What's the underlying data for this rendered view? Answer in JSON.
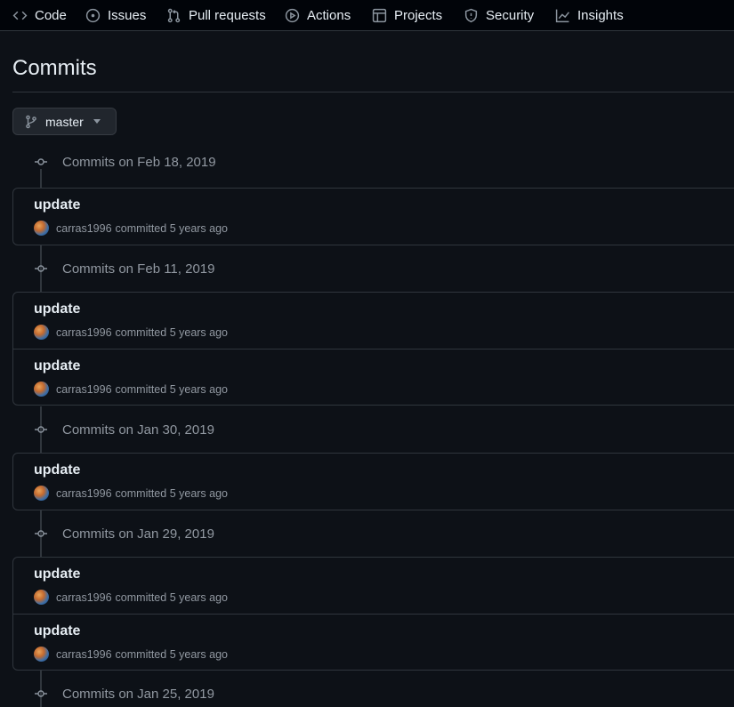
{
  "nav": {
    "items": [
      {
        "label": "Code",
        "icon": "code-icon"
      },
      {
        "label": "Issues",
        "icon": "issue-opened-icon"
      },
      {
        "label": "Pull requests",
        "icon": "git-pull-request-icon"
      },
      {
        "label": "Actions",
        "icon": "play-icon"
      },
      {
        "label": "Projects",
        "icon": "table-icon"
      },
      {
        "label": "Security",
        "icon": "shield-icon"
      },
      {
        "label": "Insights",
        "icon": "graph-icon"
      }
    ]
  },
  "page": {
    "title": "Commits",
    "branch": "master"
  },
  "groups": [
    {
      "label": "Commits on Feb 18, 2019",
      "commits": [
        {
          "title": "update",
          "author": "carras1996",
          "verb": "committed",
          "time": "5 years ago"
        }
      ]
    },
    {
      "label": "Commits on Feb 11, 2019",
      "commits": [
        {
          "title": "update",
          "author": "carras1996",
          "verb": "committed",
          "time": "5 years ago"
        },
        {
          "title": "update",
          "author": "carras1996",
          "verb": "committed",
          "time": "5 years ago"
        }
      ]
    },
    {
      "label": "Commits on Jan 30, 2019",
      "commits": [
        {
          "title": "update",
          "author": "carras1996",
          "verb": "committed",
          "time": "5 years ago"
        }
      ]
    },
    {
      "label": "Commits on Jan 29, 2019",
      "commits": [
        {
          "title": "update",
          "author": "carras1996",
          "verb": "committed",
          "time": "5 years ago"
        },
        {
          "title": "update",
          "author": "carras1996",
          "verb": "committed",
          "time": "5 years ago"
        }
      ]
    },
    {
      "label": "Commits on Jan 25, 2019",
      "commits": []
    }
  ],
  "colors": {
    "background": "#0d1117",
    "border": "#30363d",
    "muted_text": "#9198a1",
    "primary_text": "#e6edf3"
  }
}
